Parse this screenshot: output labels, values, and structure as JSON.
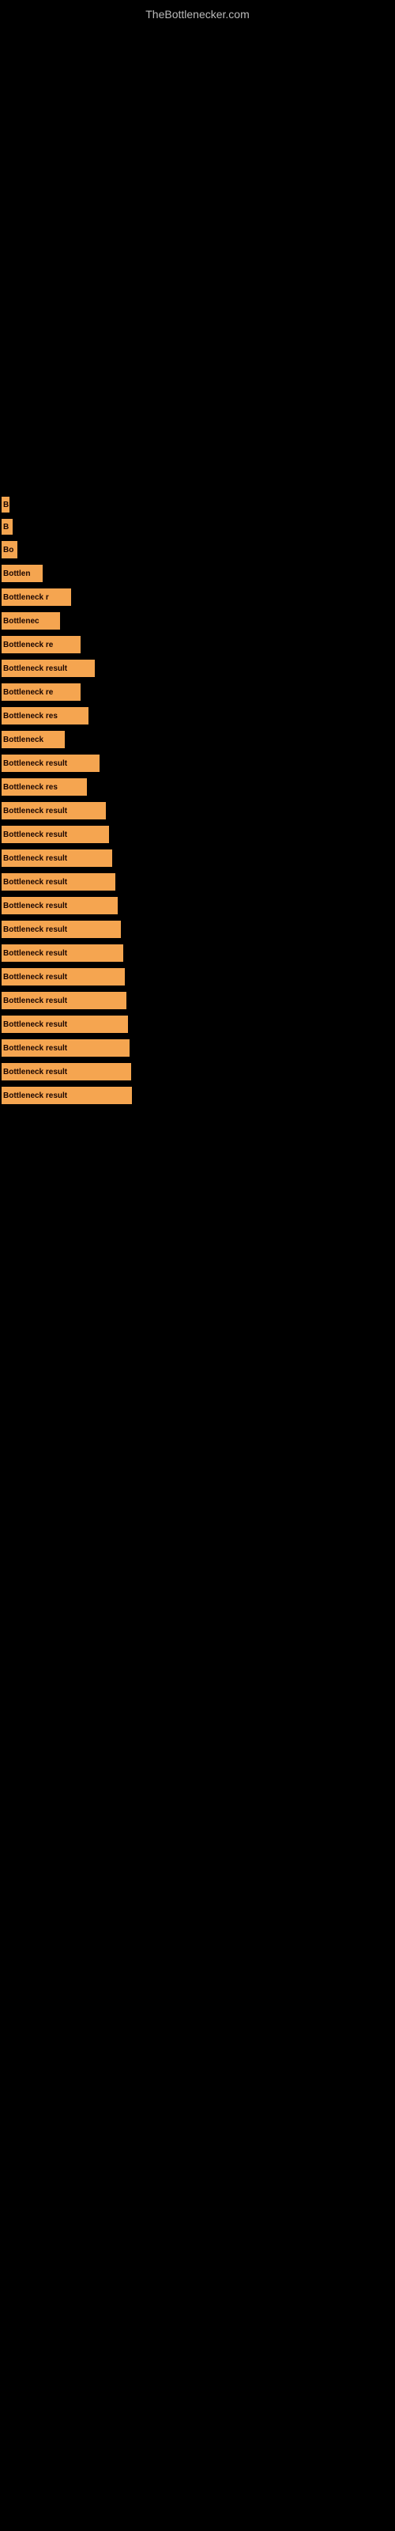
{
  "site": {
    "title": "TheBottlenecker.com"
  },
  "bars": [
    {
      "id": 1,
      "label": "B",
      "width": 8,
      "text": "B"
    },
    {
      "id": 2,
      "label": "B",
      "width": 12,
      "text": "B"
    },
    {
      "id": 3,
      "label": "Bo",
      "width": 18,
      "text": "Bo"
    },
    {
      "id": 4,
      "label": "Bottlen",
      "width": 50,
      "text": "Bottlen"
    },
    {
      "id": 5,
      "label": "Bottleneck r",
      "width": 85,
      "text": "Bottleneck r"
    },
    {
      "id": 6,
      "label": "Bottlenec",
      "width": 72,
      "text": "Bottlenec"
    },
    {
      "id": 7,
      "label": "Bottleneck re",
      "width": 96,
      "text": "Bottleneck re"
    },
    {
      "id": 8,
      "label": "Bottleneck result",
      "width": 115,
      "text": "Bottleneck result"
    },
    {
      "id": 9,
      "label": "Bottleneck re",
      "width": 98,
      "text": "Bottleneck re"
    },
    {
      "id": 10,
      "label": "Bottleneck res",
      "width": 108,
      "text": "Bottleneck res"
    },
    {
      "id": 11,
      "label": "Bottleneck",
      "width": 78,
      "text": "Bottleneck"
    },
    {
      "id": 12,
      "label": "Bottleneck result",
      "width": 120,
      "text": "Bottleneck result"
    },
    {
      "id": 13,
      "label": "Bottleneck res",
      "width": 106,
      "text": "Bottleneck res"
    },
    {
      "id": 14,
      "label": "Bottleneck result",
      "width": 130,
      "text": "Bottleneck result"
    },
    {
      "id": 15,
      "label": "Bottleneck result",
      "width": 132,
      "text": "Bottleneck result"
    },
    {
      "id": 16,
      "label": "Bottleneck result",
      "width": 138,
      "text": "Bottleneck result"
    },
    {
      "id": 17,
      "label": "Bottleneck result",
      "width": 140,
      "text": "Bottleneck result"
    },
    {
      "id": 18,
      "label": "Bottleneck result",
      "width": 144,
      "text": "Bottleneck result"
    },
    {
      "id": 19,
      "label": "Bottleneck result",
      "width": 148,
      "text": "Bottleneck result"
    },
    {
      "id": 20,
      "label": "Bottleneck result",
      "width": 150,
      "text": "Bottleneck result"
    },
    {
      "id": 21,
      "label": "Bottleneck result",
      "width": 152,
      "text": "Bottleneck result"
    },
    {
      "id": 22,
      "label": "Bottleneck result",
      "width": 154,
      "text": "Bottleneck result"
    },
    {
      "id": 23,
      "label": "Bottleneck result",
      "width": 156,
      "text": "Bottleneck result"
    },
    {
      "id": 24,
      "label": "Bottleneck result",
      "width": 158,
      "text": "Bottleneck result"
    },
    {
      "id": 25,
      "label": "Bottleneck result",
      "width": 160,
      "text": "Bottleneck result"
    },
    {
      "id": 26,
      "label": "Bottleneck result",
      "width": 162,
      "text": "Bottleneck result"
    }
  ]
}
